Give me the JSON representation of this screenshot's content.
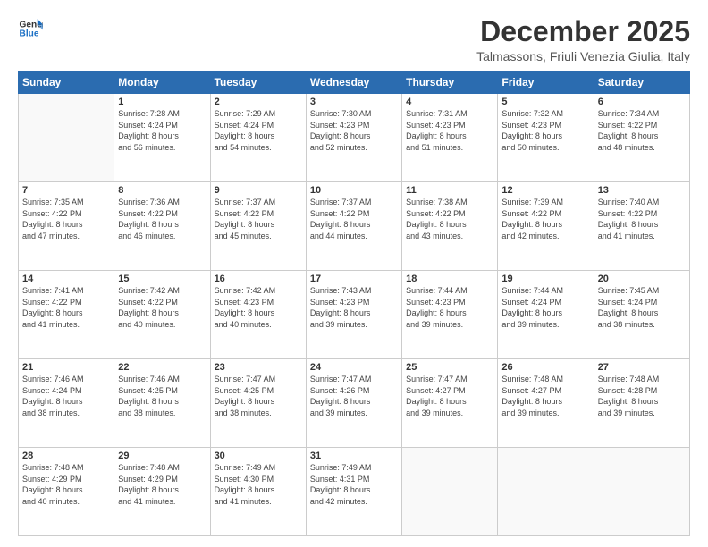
{
  "logo": {
    "line1": "General",
    "line2": "Blue"
  },
  "title": "December 2025",
  "location": "Talmassons, Friuli Venezia Giulia, Italy",
  "days_header": [
    "Sunday",
    "Monday",
    "Tuesday",
    "Wednesday",
    "Thursday",
    "Friday",
    "Saturday"
  ],
  "weeks": [
    [
      {
        "num": "",
        "info": ""
      },
      {
        "num": "1",
        "info": "Sunrise: 7:28 AM\nSunset: 4:24 PM\nDaylight: 8 hours\nand 56 minutes."
      },
      {
        "num": "2",
        "info": "Sunrise: 7:29 AM\nSunset: 4:24 PM\nDaylight: 8 hours\nand 54 minutes."
      },
      {
        "num": "3",
        "info": "Sunrise: 7:30 AM\nSunset: 4:23 PM\nDaylight: 8 hours\nand 52 minutes."
      },
      {
        "num": "4",
        "info": "Sunrise: 7:31 AM\nSunset: 4:23 PM\nDaylight: 8 hours\nand 51 minutes."
      },
      {
        "num": "5",
        "info": "Sunrise: 7:32 AM\nSunset: 4:23 PM\nDaylight: 8 hours\nand 50 minutes."
      },
      {
        "num": "6",
        "info": "Sunrise: 7:34 AM\nSunset: 4:22 PM\nDaylight: 8 hours\nand 48 minutes."
      }
    ],
    [
      {
        "num": "7",
        "info": "Sunrise: 7:35 AM\nSunset: 4:22 PM\nDaylight: 8 hours\nand 47 minutes."
      },
      {
        "num": "8",
        "info": "Sunrise: 7:36 AM\nSunset: 4:22 PM\nDaylight: 8 hours\nand 46 minutes."
      },
      {
        "num": "9",
        "info": "Sunrise: 7:37 AM\nSunset: 4:22 PM\nDaylight: 8 hours\nand 45 minutes."
      },
      {
        "num": "10",
        "info": "Sunrise: 7:37 AM\nSunset: 4:22 PM\nDaylight: 8 hours\nand 44 minutes."
      },
      {
        "num": "11",
        "info": "Sunrise: 7:38 AM\nSunset: 4:22 PM\nDaylight: 8 hours\nand 43 minutes."
      },
      {
        "num": "12",
        "info": "Sunrise: 7:39 AM\nSunset: 4:22 PM\nDaylight: 8 hours\nand 42 minutes."
      },
      {
        "num": "13",
        "info": "Sunrise: 7:40 AM\nSunset: 4:22 PM\nDaylight: 8 hours\nand 41 minutes."
      }
    ],
    [
      {
        "num": "14",
        "info": "Sunrise: 7:41 AM\nSunset: 4:22 PM\nDaylight: 8 hours\nand 41 minutes."
      },
      {
        "num": "15",
        "info": "Sunrise: 7:42 AM\nSunset: 4:22 PM\nDaylight: 8 hours\nand 40 minutes."
      },
      {
        "num": "16",
        "info": "Sunrise: 7:42 AM\nSunset: 4:23 PM\nDaylight: 8 hours\nand 40 minutes."
      },
      {
        "num": "17",
        "info": "Sunrise: 7:43 AM\nSunset: 4:23 PM\nDaylight: 8 hours\nand 39 minutes."
      },
      {
        "num": "18",
        "info": "Sunrise: 7:44 AM\nSunset: 4:23 PM\nDaylight: 8 hours\nand 39 minutes."
      },
      {
        "num": "19",
        "info": "Sunrise: 7:44 AM\nSunset: 4:24 PM\nDaylight: 8 hours\nand 39 minutes."
      },
      {
        "num": "20",
        "info": "Sunrise: 7:45 AM\nSunset: 4:24 PM\nDaylight: 8 hours\nand 38 minutes."
      }
    ],
    [
      {
        "num": "21",
        "info": "Sunrise: 7:46 AM\nSunset: 4:24 PM\nDaylight: 8 hours\nand 38 minutes."
      },
      {
        "num": "22",
        "info": "Sunrise: 7:46 AM\nSunset: 4:25 PM\nDaylight: 8 hours\nand 38 minutes."
      },
      {
        "num": "23",
        "info": "Sunrise: 7:47 AM\nSunset: 4:25 PM\nDaylight: 8 hours\nand 38 minutes."
      },
      {
        "num": "24",
        "info": "Sunrise: 7:47 AM\nSunset: 4:26 PM\nDaylight: 8 hours\nand 39 minutes."
      },
      {
        "num": "25",
        "info": "Sunrise: 7:47 AM\nSunset: 4:27 PM\nDaylight: 8 hours\nand 39 minutes."
      },
      {
        "num": "26",
        "info": "Sunrise: 7:48 AM\nSunset: 4:27 PM\nDaylight: 8 hours\nand 39 minutes."
      },
      {
        "num": "27",
        "info": "Sunrise: 7:48 AM\nSunset: 4:28 PM\nDaylight: 8 hours\nand 39 minutes."
      }
    ],
    [
      {
        "num": "28",
        "info": "Sunrise: 7:48 AM\nSunset: 4:29 PM\nDaylight: 8 hours\nand 40 minutes."
      },
      {
        "num": "29",
        "info": "Sunrise: 7:48 AM\nSunset: 4:29 PM\nDaylight: 8 hours\nand 41 minutes."
      },
      {
        "num": "30",
        "info": "Sunrise: 7:49 AM\nSunset: 4:30 PM\nDaylight: 8 hours\nand 41 minutes."
      },
      {
        "num": "31",
        "info": "Sunrise: 7:49 AM\nSunset: 4:31 PM\nDaylight: 8 hours\nand 42 minutes."
      },
      {
        "num": "",
        "info": ""
      },
      {
        "num": "",
        "info": ""
      },
      {
        "num": "",
        "info": ""
      }
    ]
  ]
}
